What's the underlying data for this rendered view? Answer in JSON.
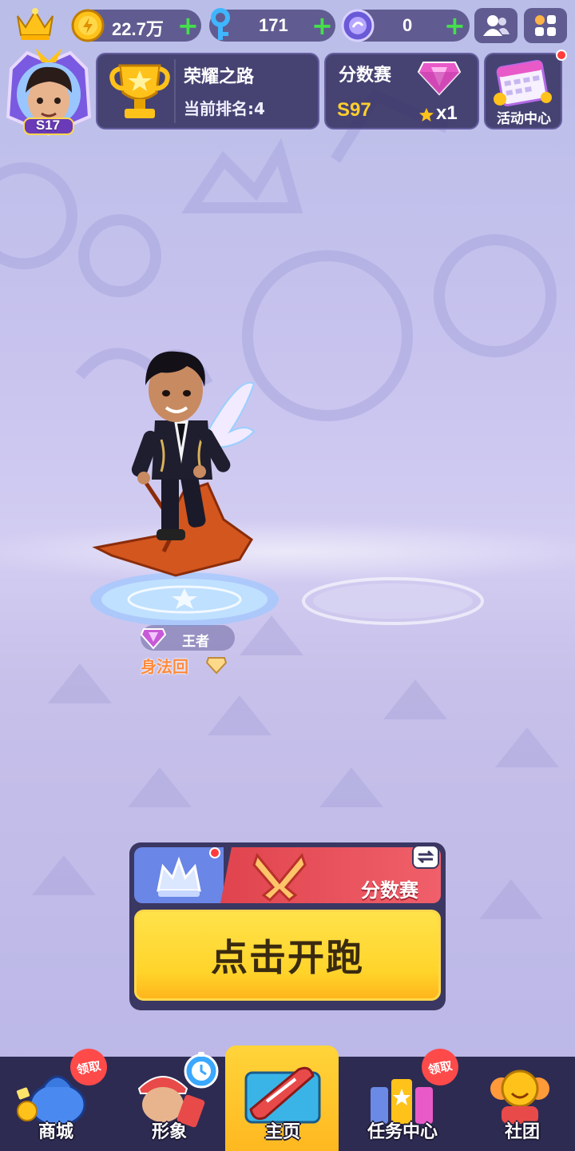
{
  "currency": {
    "gold": "22.7万",
    "keys": "171",
    "gems": "0",
    "plus": "+"
  },
  "profile": {
    "level": "S17"
  },
  "glory_road": {
    "title": "荣耀之路",
    "rank_label": "当前排名:4"
  },
  "score_match": {
    "title": "分数赛",
    "season": "S97",
    "stars": "x1"
  },
  "event_center": {
    "label": "活动中心"
  },
  "player": {
    "rank_name": "王者",
    "title_name": "身法回"
  },
  "start_panel": {
    "mode": "分数赛",
    "start_label": "点击开跑"
  },
  "nav": {
    "items": [
      {
        "label": "商城",
        "badge": "领取"
      },
      {
        "label": "形象",
        "badge": ""
      },
      {
        "label": "主页",
        "badge": ""
      },
      {
        "label": "任务中心",
        "badge": "领取"
      },
      {
        "label": "社团",
        "badge": ""
      }
    ]
  },
  "colors": {
    "accent_yellow": "#ffd42a",
    "mode_red": "#e0444e",
    "panel_dark": "#322e60",
    "plus_green": "#44e04c"
  }
}
